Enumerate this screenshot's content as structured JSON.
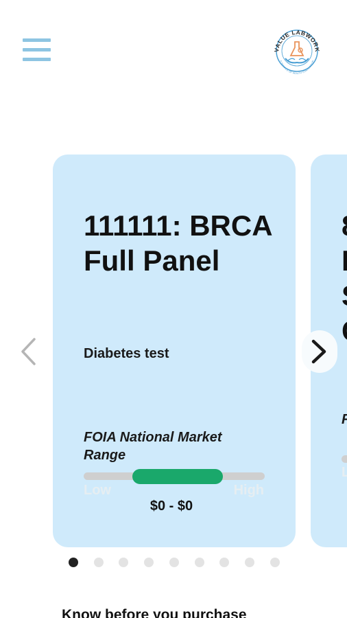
{
  "header": {
    "menu_icon": "hamburger-menu-icon",
    "logo": {
      "text_top": "VALUE LABWORK",
      "text_bottom": "A SERVICE OF HEALTH CONNECTION"
    },
    "colors": {
      "menu": "#8ec5e2",
      "logo_accent": "#e9935a",
      "logo_primary": "#4a9fd4"
    }
  },
  "carousel": {
    "current_index": 0,
    "prev_icon": "chevron-left-icon",
    "next_icon": "chevron-right-icon",
    "cards": [
      {
        "code_title": "111111: BRCA Full Panel",
        "description": "Diabetes test",
        "range_label": "FOIA National Market Range",
        "range_low_label": "Low",
        "range_high_label": "High",
        "range_fill_start": 0.27,
        "range_fill_end": 0.77,
        "price_range": "$0 - $0"
      },
      {
        "title_fragment": "8 I S C",
        "range_label_fragment": "F F",
        "range_low_fragment": "L"
      }
    ],
    "dot_count": 9,
    "colors": {
      "card_bg": "#cfeafb",
      "range_fill": "#1aa86b",
      "range_track": "#cfcfcf",
      "dot_active": "#222222",
      "dot_inactive": "#e3e3e3"
    }
  },
  "footer": {
    "know_text": "Know before you purchase"
  }
}
